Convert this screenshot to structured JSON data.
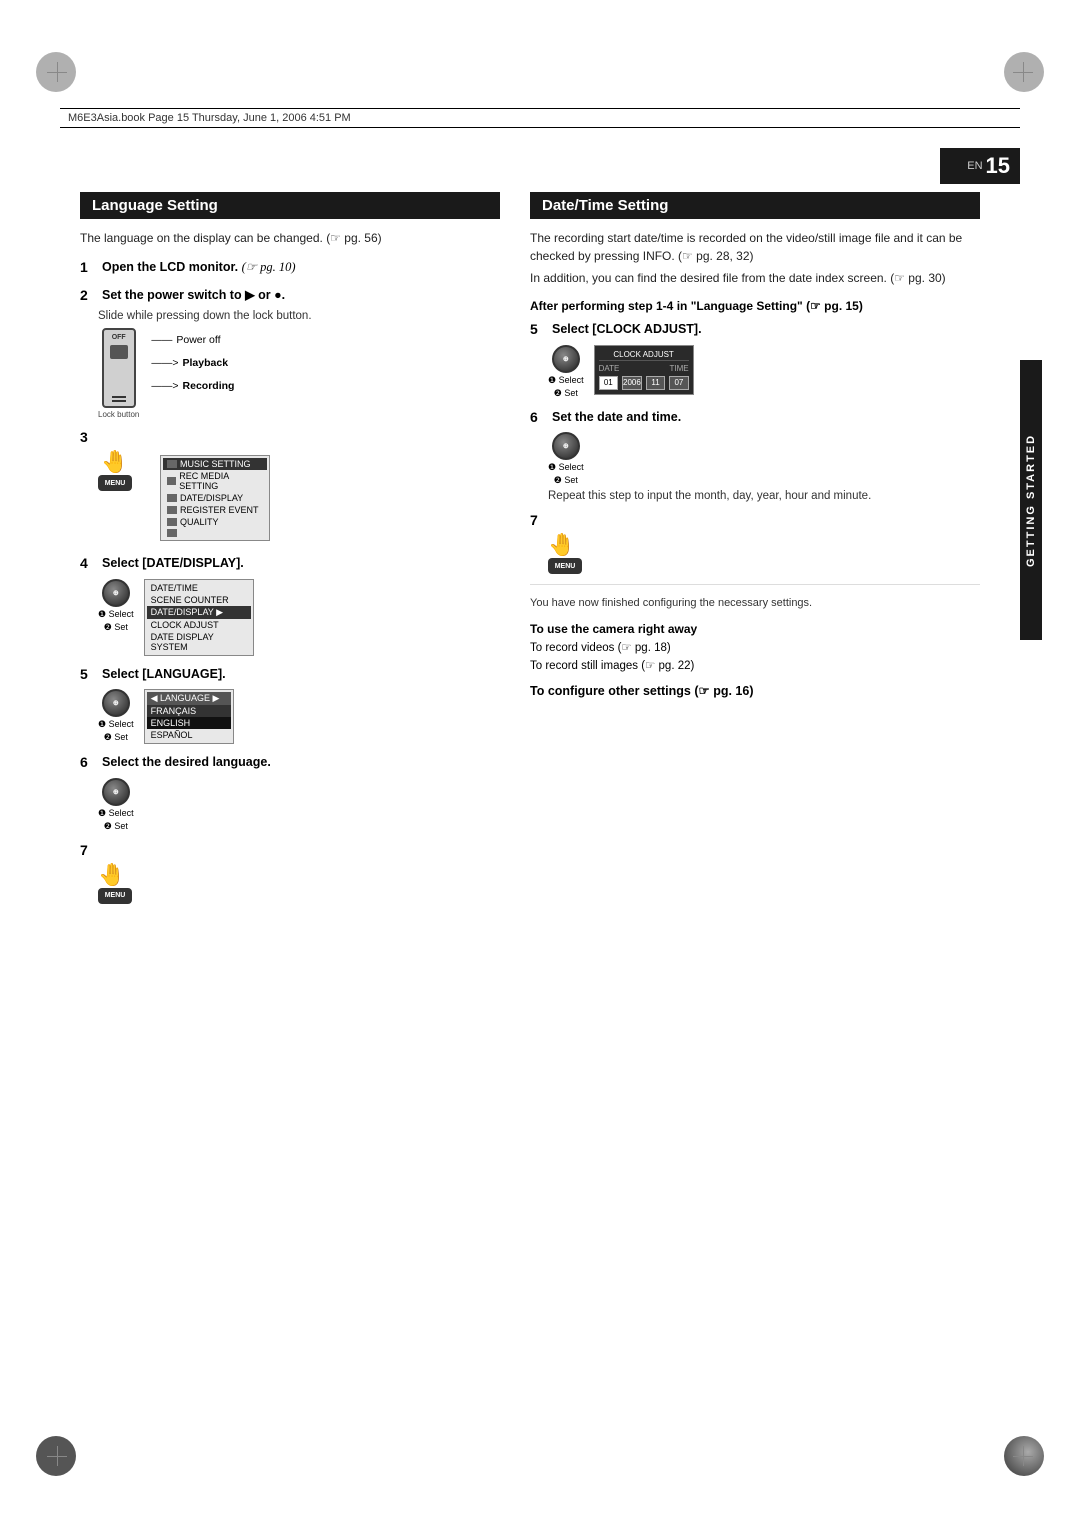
{
  "page": {
    "number": "15",
    "en_label": "EN",
    "book_info": "M6E3Asia.book  Page 15  Thursday, June 1, 2006  4:51 PM",
    "sidebar_label": "GETTING STARTED"
  },
  "left_section": {
    "title": "Language Setting",
    "intro": "The language on the display can be changed. (☞ pg. 56)",
    "steps": [
      {
        "num": "1",
        "text": "Open the LCD monitor. (☞ pg. 10)"
      },
      {
        "num": "2",
        "text": "Set the power switch to ▶ or ●.",
        "sub": "Slide while pressing down the lock button."
      },
      {
        "num": "3",
        "text": ""
      },
      {
        "num": "4",
        "text": "Select [DATE/DISPLAY].",
        "select": "❶ Select",
        "set": "❷ Set"
      },
      {
        "num": "5",
        "text": "Select [LANGUAGE].",
        "select": "❶ Select",
        "set": "❷ Set"
      },
      {
        "num": "6",
        "text": "Select the desired language.",
        "select": "❶ Select",
        "set": "❷ Set"
      },
      {
        "num": "7",
        "text": ""
      }
    ],
    "power_labels": {
      "off": "OFF",
      "playback": "Playback",
      "recording": "Recording",
      "lock": "Lock button",
      "power_off": "Power off"
    },
    "date_display_menu": {
      "items": [
        "DATE/TIME",
        "SCENE COUNTER",
        "DATE/DISPLAY",
        "CLOCK ADJUST",
        "DATE DISPLAY SYSTEM"
      ],
      "selected_index": 2
    },
    "date_display_submenu": {
      "items": [
        "DATE/TIME",
        "SCENE COUNTER",
        "DATE/DISPLAY",
        "CLOCK ADJUST",
        "DATE DISPLAY SYSTEM"
      ],
      "selected_index": 2
    },
    "language_menu": {
      "items": [
        "FRANÇAIS",
        "ENGLISH",
        "ESPAÑOL"
      ],
      "selected_index": 1
    }
  },
  "right_section": {
    "title": "Date/Time Setting",
    "intro_lines": [
      "The recording start date/time is recorded on the video/still image file and it can be checked by pressing INFO. (☞ pg. 28, 32)",
      "In addition, you can find the desired file from the date index screen. (☞ pg. 30)"
    ],
    "after_performing": "After performing step 1-4 in \"Language Setting\" (☞ pg. 15)",
    "steps": [
      {
        "num": "5",
        "text": "Select [CLOCK ADJUST].",
        "select": "❶ Select",
        "set": "❷ Set"
      },
      {
        "num": "6",
        "text": "Set the date and time.",
        "select": "❶ Select",
        "set": "❷ Set",
        "note": "Repeat this step to input the month, day, year, hour and minute."
      },
      {
        "num": "7",
        "text": ""
      }
    ],
    "clock_screen": {
      "title": "CLOCK ADJUST",
      "col_date": "DATE",
      "col_time": "TIME",
      "values": [
        "01",
        "2006",
        "11",
        "07"
      ],
      "active_index": 0
    },
    "completion_text": "You have now finished configuring the necessary settings.",
    "camera_right_away": {
      "header": "To use the camera right away",
      "lines": [
        "To record videos (☞ pg. 18)",
        "To record still images (☞ pg. 22)"
      ]
    },
    "other_settings": "To configure other settings (☞ pg. 16)"
  }
}
